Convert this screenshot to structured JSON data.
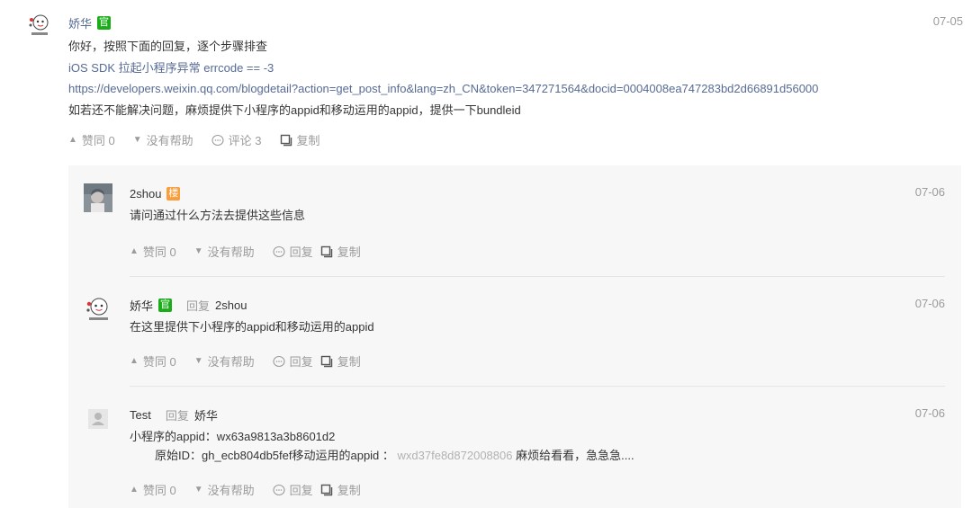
{
  "post": {
    "author": "娇华",
    "badge": "官",
    "date": "07-05",
    "lines": [
      "你好，按照下面的回复，逐个步骤排查",
      "iOS SDK 拉起小程序异常 errcode == -3",
      "https://developers.weixin.qq.com/blogdetail?action=get_post_info&lang=zh_CN&token=347271564&docid=0004008ea747283bd2d66891d56000",
      "如若还不能解决问题，麻烦提供下小程序的appid和移动运用的appid，提供一下bundleid"
    ],
    "actions": {
      "upvote": "赞同 0",
      "unhelpful": "没有帮助",
      "comment": "评论 3",
      "copy": "复制"
    }
  },
  "replies": [
    {
      "author": "2shou",
      "badge": "楼",
      "reply_to_label": "",
      "reply_to": "",
      "date": "07-06",
      "lines": [
        "请问通过什么方法去提供这些信息"
      ]
    },
    {
      "author": "娇华",
      "badge": "官",
      "reply_to_label": "回复",
      "reply_to": "2shou",
      "date": "07-06",
      "lines": [
        "在这里提供下小程序的appid和移动运用的appid"
      ]
    },
    {
      "author": "Test",
      "badge": "",
      "reply_to_label": "回复",
      "reply_to": "娇华",
      "date": "07-06",
      "line1": "小程序的appid：wx63a9813a3b8601d2",
      "line2_a": "原始ID：gh_ecb804db5fef移动运用的appid ：",
      "line2_b": "wxd37fe8d872008806",
      "line2_c": "麻烦给看看，急急急...."
    }
  ],
  "reply_actions": {
    "upvote": "赞同 0",
    "unhelpful": "没有帮助",
    "reply": "回复",
    "copy": "复制"
  },
  "colors": {
    "official_badge": "#1aad19",
    "floor_badge": "#fa9d3b",
    "link": "#576b95",
    "muted": "#9b9b9b",
    "reply_bg": "#f7f7f7"
  }
}
